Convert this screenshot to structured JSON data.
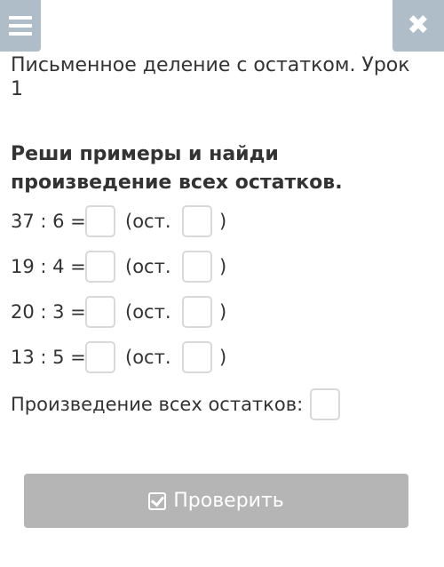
{
  "header": {
    "menu_icon": "hamburger-icon",
    "close_icon": "close-icon",
    "close_glyph": "✖"
  },
  "lesson": {
    "title": "Письменное деление с остатком. Урок 1"
  },
  "task": {
    "title": "Реши примеры и найди произведение всех остатков.",
    "rows": [
      {
        "expression": "37 : 6 =",
        "remainder_label": "(ост.",
        "close": ")",
        "answer": "",
        "remainder": ""
      },
      {
        "expression": "19 : 4 =",
        "remainder_label": "(ост.",
        "close": ")",
        "answer": "",
        "remainder": ""
      },
      {
        "expression": "20 : 3 =",
        "remainder_label": "(ост.",
        "close": ")",
        "answer": "",
        "remainder": ""
      },
      {
        "expression": "13 : 5 =",
        "remainder_label": "(ост.",
        "close": ")",
        "answer": "",
        "remainder": ""
      }
    ],
    "product_label": "Произведение всех остатков:",
    "product_value": ""
  },
  "actions": {
    "check_label": "Проверить",
    "check_icon": "checkbox-icon"
  },
  "colors": {
    "top_button_bg": "#aebdc7",
    "check_button_bg": "#b5b5b5",
    "input_border": "#d9d9d9",
    "text": "#333333"
  }
}
